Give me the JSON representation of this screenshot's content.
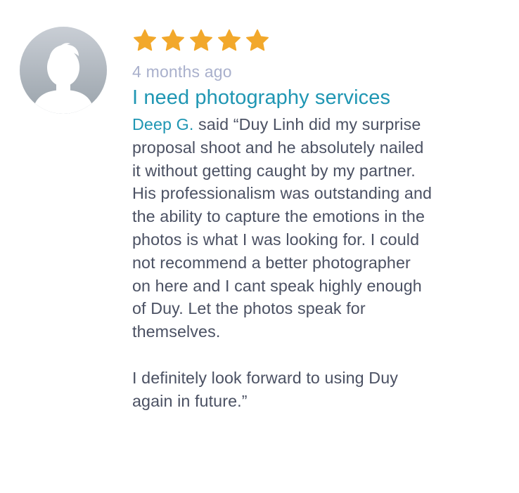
{
  "review": {
    "rating": 5,
    "rating_max": 5,
    "star_color": "#f2a82b",
    "time_ago": "4 months ago",
    "title": "I need photography services",
    "author": "Deep G.",
    "said": " said ",
    "quote": "“Duy Linh did my surprise\nproposal shoot and he absolutely nailed\nit without getting caught by my partner.\nHis professionalism was outstanding and\nthe ability to capture the emotions in the\nphotos is what I was looking for. I could\nnot recommend a better photographer\non here and I cant speak highly enough\nof Duy. Let the photos speak for\nthemselves.\n\nI definitely look forward to using Duy\nagain in future.”",
    "avatar_icon": "default-user-avatar-icon",
    "colors": {
      "link": "#1f96b3",
      "muted": "#a9b0cc",
      "text": "#4b5163"
    }
  }
}
